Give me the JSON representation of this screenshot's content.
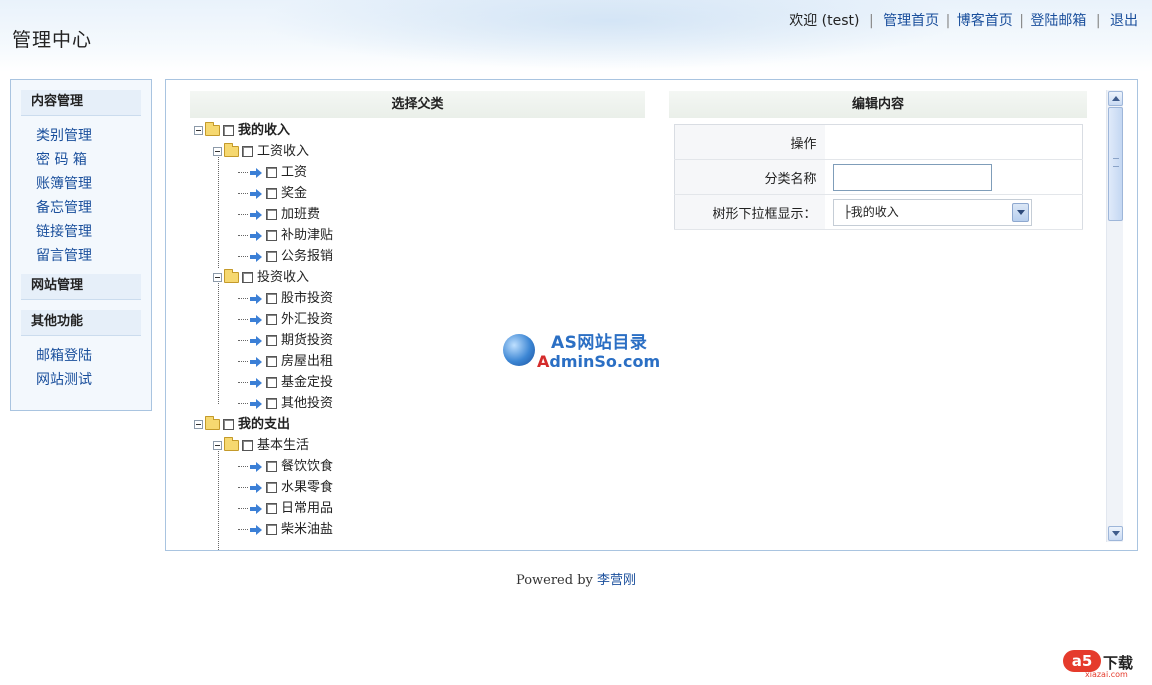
{
  "header": {
    "title": "管理中心",
    "welcome": "欢迎 (test)",
    "links": [
      "管理首页",
      "博客首页",
      "登陆邮箱",
      "退出"
    ]
  },
  "sidebar": {
    "sections": [
      {
        "title": "内容管理",
        "items": [
          "类别管理",
          "密 码 箱",
          "账簿管理",
          "备忘管理",
          "链接管理",
          "留言管理"
        ]
      },
      {
        "title": "网站管理",
        "items": []
      },
      {
        "title": "其他功能",
        "items": [
          "邮箱登陆",
          "网站测试"
        ]
      }
    ]
  },
  "main": {
    "left_title": "选择父类",
    "right_title": "编辑内容",
    "tree": {
      "root1": "我的收入",
      "g1": "工资收入",
      "g1_items": [
        "工资",
        "奖金",
        "加班费",
        "补助津贴",
        "公务报销"
      ],
      "g2": "投资收入",
      "g2_items": [
        "股市投资",
        "外汇投资",
        "期货投资",
        "房屋出租",
        "基金定投",
        "其他投资"
      ],
      "root2": "我的支出",
      "g3": "基本生活",
      "g3_items": [
        "餐饮饮食",
        "水果零食",
        "日常用品",
        "柴米油盐"
      ]
    },
    "form": {
      "operation_label": "操作",
      "operation_value": "",
      "name_label": "分类名称",
      "name_value": "",
      "parent_label": "树形下拉框显示：",
      "parent_value": "├我的收入"
    }
  },
  "watermark": {
    "top": "AS网站目录",
    "bottom_red": "A",
    "bottom_blue": "dminSo.com"
  },
  "footer": {
    "prefix": "Powered by",
    "author": "李营刚"
  },
  "corner_logo": {
    "mark": "a5",
    "text": "下载",
    "sub": "xiazai.com"
  }
}
